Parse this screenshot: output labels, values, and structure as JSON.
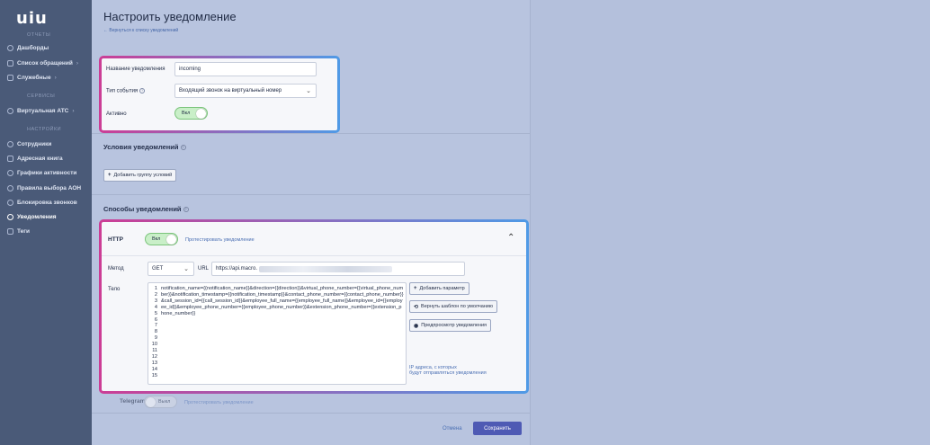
{
  "sidebar": {
    "logo": "uiu",
    "sections": {
      "reports": "ОТЧЕТЫ",
      "services": "СЕРВИСЫ",
      "settings": "НАСТРОЙКИ"
    },
    "items": [
      {
        "label": "Дашборды",
        "icon": "dashboard-icon"
      },
      {
        "label": "Список обращений",
        "icon": "list-icon",
        "chevron": "›"
      },
      {
        "label": "Служебные",
        "icon": "folder-icon",
        "chevron": "›"
      },
      {
        "label": "Виртуальная АТС",
        "icon": "gear-icon",
        "chevron": "›"
      },
      {
        "label": "Сотрудники",
        "icon": "users-icon"
      },
      {
        "label": "Адресная книга",
        "icon": "book-icon"
      },
      {
        "label": "Графики активности",
        "icon": "clock-icon"
      },
      {
        "label": "Правила выбора АОН",
        "icon": "rules-icon"
      },
      {
        "label": "Блокировка звонков",
        "icon": "block-icon"
      },
      {
        "label": "Уведомления",
        "icon": "bell-icon"
      },
      {
        "label": "Теги",
        "icon": "tag-icon"
      }
    ]
  },
  "header": {
    "title": "Настроить уведомление",
    "back_link": "← Вернуться к списку уведомлений"
  },
  "general": {
    "name_label": "Название уведомления",
    "name_value": "incoming",
    "event_label": "Тип события",
    "event_value": "Входящий звонок на виртуальный номер",
    "active_label": "Активно",
    "active_toggle": "Вкл"
  },
  "conditions": {
    "title": "Условия уведомлений",
    "add_group_button": "Добавить группу условий"
  },
  "methods": {
    "title": "Способы уведомлений",
    "http": {
      "label": "HTTP",
      "toggle": "Вкл",
      "test_link": "Протестировать уведомление",
      "method_label": "Метод",
      "method_value": "GET",
      "url_label": "URL",
      "url_value": "https://api.macro.",
      "body_label": "Тело",
      "line_numbers": [
        "1",
        "2",
        "3",
        "4",
        "5",
        "6",
        "7",
        "8",
        "9",
        "10",
        "11",
        "12",
        "13",
        "14",
        "15"
      ],
      "body_text": "notification_name={{notification_name}}&direction={{direction}}&virtual_phone_number={{virtual_phone_number}}&notification_timestamp={{notification_timestamp}}&contact_phone_number={{contact_phone_number}}&call_session_id={{call_session_id}}&employee_full_name={{employee_full_name}}&employee_id={{employee_id}}&employee_phone_number={{employee_phone_number}}&extension_phone_number={{extension_phone_number}}",
      "add_param_button": "Добавить параметр",
      "reset_template_button": "Вернуть шаблон по умолчанию",
      "preview_button": "Предпросмотр уведомления",
      "ip_link_line1": "IP адреса, с которых",
      "ip_link_line2": "будут отправляться уведомления"
    },
    "telegram": {
      "label": "Telegram",
      "toggle": "Выкл",
      "test_link": "Протестировать уведомление"
    }
  },
  "footer": {
    "cancel": "Отмена",
    "save": "Сохранить"
  },
  "colors": {
    "sidebar": "#4a5a78",
    "accent": "#4e5ab4",
    "toggle_on": "#c9efc8",
    "highlight_gradient_start": "#cc3d95",
    "highlight_gradient_end": "#4f9ae6"
  }
}
